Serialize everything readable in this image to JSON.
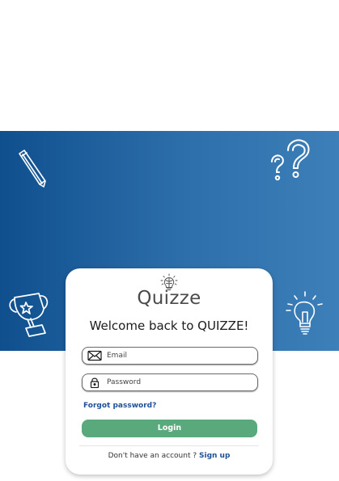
{
  "app": {
    "logo_text": "Quizze"
  },
  "login": {
    "heading": "Welcome back to QUIZZE!",
    "email_placeholder": "Email",
    "password_placeholder": "Password",
    "forgot_password": "Forgot password?",
    "login_button": "Login",
    "no_account_text": "Don't have an account ?",
    "sign_up_link": "Sign up"
  },
  "decorations": [
    "pencil-icon",
    "question-marks-icon",
    "trophy-icon",
    "lightbulb-icon",
    "brain-lightbulb-icon"
  ],
  "colors": {
    "banner_start": "#0f4f8e",
    "banner_end": "#3d7fb8",
    "login_button": "#5aa97c",
    "link": "#1f4f97"
  }
}
